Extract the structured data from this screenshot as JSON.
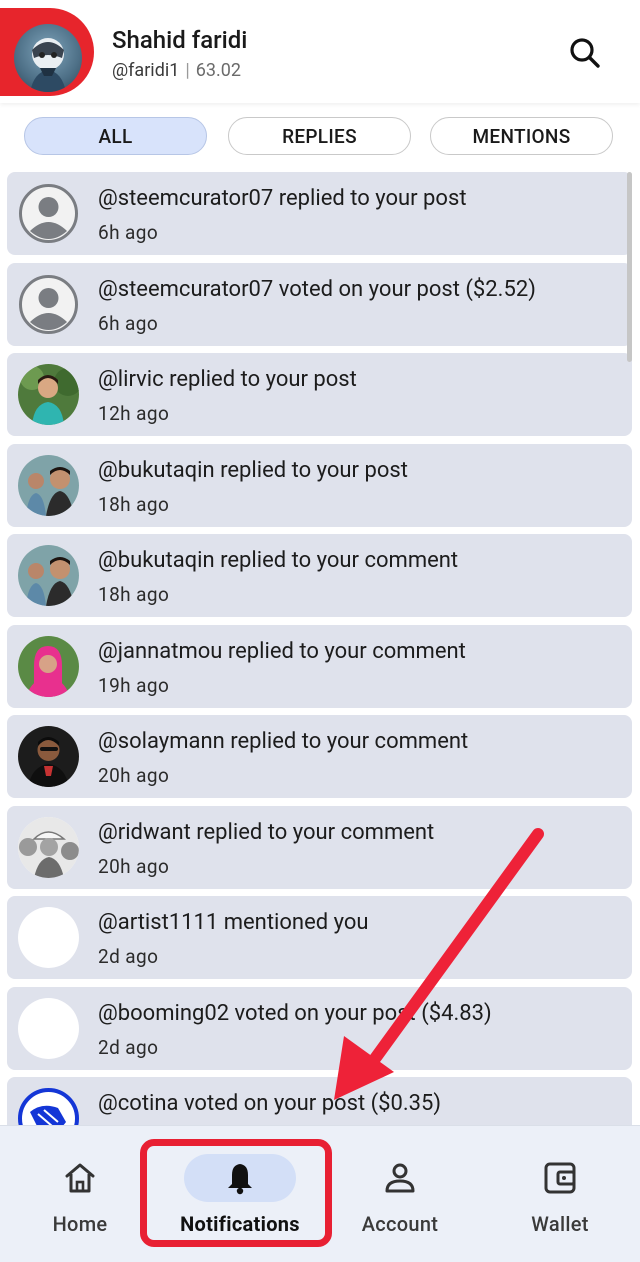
{
  "header": {
    "name": "Shahid faridi",
    "handle": "@faridi1",
    "separator": "|",
    "reputation": "63.02"
  },
  "tabs": [
    {
      "label": "ALL",
      "active": true
    },
    {
      "label": "REPLIES",
      "active": false
    },
    {
      "label": "MENTIONS",
      "active": false
    }
  ],
  "notifications": [
    {
      "text": "@steemcurator07 replied to your post",
      "time": "6h ago"
    },
    {
      "text": "@steemcurator07 voted on your post ($2.52)",
      "time": "6h ago"
    },
    {
      "text": "@lirvic replied to your post",
      "time": "12h ago"
    },
    {
      "text": "@bukutaqin replied to your post",
      "time": "18h ago"
    },
    {
      "text": "@bukutaqin replied to your comment",
      "time": "18h ago"
    },
    {
      "text": "@jannatmou replied to your comment",
      "time": "19h ago"
    },
    {
      "text": "@solaymann replied to your comment",
      "time": "20h ago"
    },
    {
      "text": "@ridwant replied to your comment",
      "time": "20h ago"
    },
    {
      "text": "@artist1111 mentioned you",
      "time": "2d ago"
    },
    {
      "text": "@booming02 voted on your post ($4.83)",
      "time": "2d ago"
    },
    {
      "text": "@cotina voted on your post ($0.35)",
      "time": ""
    }
  ],
  "nav": [
    {
      "label": "Home",
      "icon": "home-icon",
      "active": false
    },
    {
      "label": "Notifications",
      "icon": "bell-icon",
      "active": true
    },
    {
      "label": "Account",
      "icon": "person-icon",
      "active": false
    },
    {
      "label": "Wallet",
      "icon": "wallet-icon",
      "active": false
    }
  ],
  "colors": {
    "accent_red": "#e82033",
    "item_bg": "#dfe2ec",
    "active_tab_bg": "#d8e3fb",
    "nav_bg": "#ecf0f8"
  }
}
